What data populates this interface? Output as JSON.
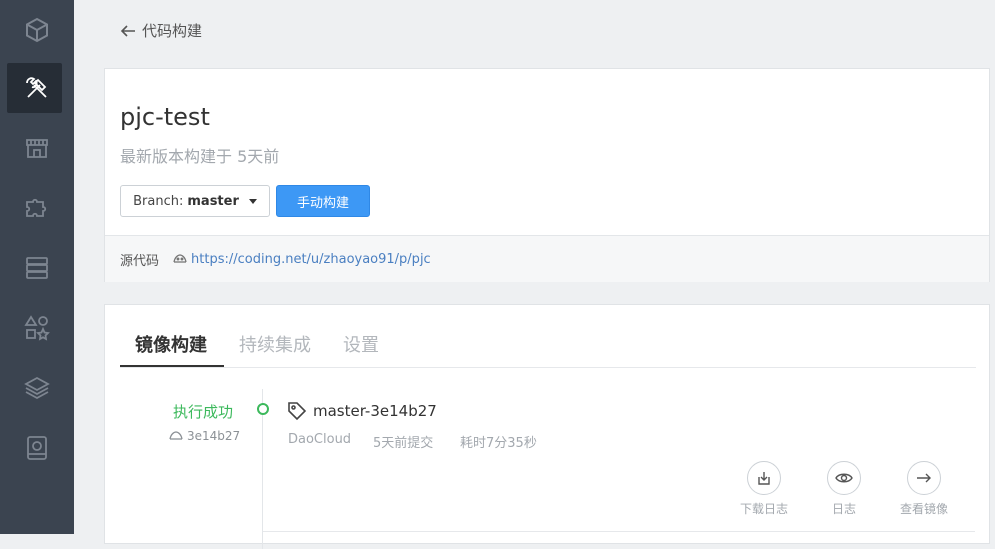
{
  "sidebar": {
    "items": [
      {
        "icon": "logo-cube-icon"
      },
      {
        "icon": "build-tools-icon",
        "active": true
      },
      {
        "icon": "store-icon"
      },
      {
        "icon": "puzzle-icon"
      },
      {
        "icon": "server-icon"
      },
      {
        "icon": "shapes-icon"
      },
      {
        "icon": "layers-icon"
      },
      {
        "icon": "storage-icon"
      }
    ]
  },
  "header": {
    "back_label": "代码构建"
  },
  "project": {
    "name": "pjc-test",
    "subtitle": "最新版本构建于 5天前",
    "branch_prefix": "Branch:",
    "branch_name": "master",
    "build_button": "手动构建",
    "source_label": "源代码",
    "source_url": "https://coding.net/u/zhaoyao91/p/pjc"
  },
  "tabs": [
    "镜像构建",
    "持续集成",
    "设置"
  ],
  "build": {
    "status": "执行成功",
    "commit": "3e14b27",
    "tag": "master-3e14b27",
    "source": "DaoCloud",
    "submitted": "5天前提交",
    "duration": "耗时7分35秒",
    "actions": [
      "下载日志",
      "日志",
      "查看镜像"
    ]
  },
  "colors": {
    "accent": "#3d98f5",
    "success": "#3cb95c",
    "sidebar": "#3b4450"
  }
}
